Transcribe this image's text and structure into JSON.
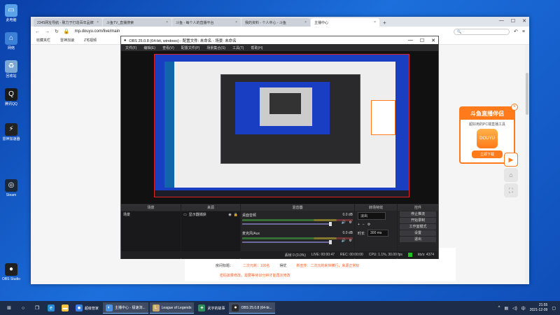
{
  "desktop": {
    "icons": [
      {
        "label": "此电脑",
        "icon": "computer-icon",
        "color": "#5aa2e8"
      },
      {
        "label": "网络",
        "icon": "network-icon",
        "color": "#3b7fd6"
      },
      {
        "label": "回收站",
        "icon": "recycle-bin-icon",
        "color": "#7aa7d4"
      },
      {
        "label": "腾讯QQ",
        "icon": "qq-icon",
        "color": "#1a1a1a"
      },
      {
        "label": "雷神加速器",
        "icon": "leishen-icon",
        "color": "#222"
      },
      {
        "label": "Steam",
        "icon": "steam-icon",
        "color": "#1b2838"
      },
      {
        "label": "OBS Studio",
        "icon": "obs-icon",
        "color": "#202020"
      }
    ]
  },
  "browser": {
    "tabs": [
      {
        "label": "2345网址导航 - 致力于打造百年品牌"
      },
      {
        "label": "斗鱼TV_直播搜索"
      },
      {
        "label": "斗鱼 - 每个人的直播平台"
      },
      {
        "label": "我的资料 - 个人中心 - 斗鱼"
      },
      {
        "label": "主播中心"
      }
    ],
    "url": "mp.douyu.com/live/main",
    "bookmarks": [
      "收藏夹栏",
      "雷神加速",
      "Z宅视频"
    ],
    "page": {
      "notice_label": "房间标题：",
      "notice_value1": "二次元新：100名",
      "notice_mid": "得优",
      "notice_hint": "新宣传：二次元的来世横行，来源正常标",
      "warning": "密码如果修改，需要等待10分钟才能再次修改"
    },
    "ad": {
      "title": "斗鱼直播伴侣",
      "subtitle": "超好用的PC端直播工具",
      "logo_text": "DOUYU",
      "button": "立即下载"
    }
  },
  "obs": {
    "title": "OBS 25.0.8 (64-bit, windows) - 配置文件: 未命名 - 场景: 未命名",
    "menu": [
      "文件(F)",
      "编辑(E)",
      "查看(V)",
      "配置文件(P)",
      "场景集合(S)",
      "工具(T)",
      "帮助(H)"
    ],
    "docks": {
      "scenes_title": "场景",
      "scene_item": "场景",
      "sources_title": "来源",
      "source_item": "显示器捕获",
      "mixer_title": "混音器",
      "mixer_rows": [
        {
          "name": "桌面音频",
          "db": "0.0 dB"
        },
        {
          "name": "麦克风/Aux",
          "db": "0.0 dB"
        }
      ],
      "transitions_title": "转场特效",
      "transition_select": "淡出",
      "duration_label": "时长",
      "duration_value": "300 ms",
      "controls_title": "控件",
      "controls": [
        "停止推流",
        "开始录制",
        "工作室模式",
        "设置",
        "退出"
      ]
    },
    "status": {
      "dropped": "丢帧 0 (0.0%)",
      "live": "LIVE: 00:00:47",
      "rec": "REC: 00:00:00",
      "cpu": "CPU: 1.1%, 30.00 fps",
      "bitrate": "kb/s: 4374"
    }
  },
  "taskbar": {
    "items": [
      {
        "label": "",
        "icon": "start-icon",
        "color": "#ffffff"
      },
      {
        "label": "",
        "icon": "search-icon",
        "color": "#ffffff"
      },
      {
        "label": "",
        "icon": "taskview-icon",
        "color": "#ffffff"
      },
      {
        "label": "",
        "icon": "edge-icon",
        "color": "#2b8ad8"
      },
      {
        "label": "",
        "icon": "folder-icon",
        "color": "#f4c542"
      },
      {
        "label": "超级管家",
        "icon": "app-icon",
        "color": "#3a7de0"
      },
      {
        "label": "主播中心 - 极速浏...",
        "icon": "browser-icon",
        "color": "#4a90e2"
      },
      {
        "label": "League of Legends",
        "icon": "lol-icon",
        "color": "#c8aa6e"
      },
      {
        "label": "武字的故事",
        "icon": "game-icon",
        "color": "#2f8f5a"
      },
      {
        "label": "OBS 25.0.8 (64-bi...",
        "icon": "obs-icon",
        "color": "#2a2a2a"
      }
    ],
    "time": "21:55",
    "date": "2021-12-09"
  }
}
